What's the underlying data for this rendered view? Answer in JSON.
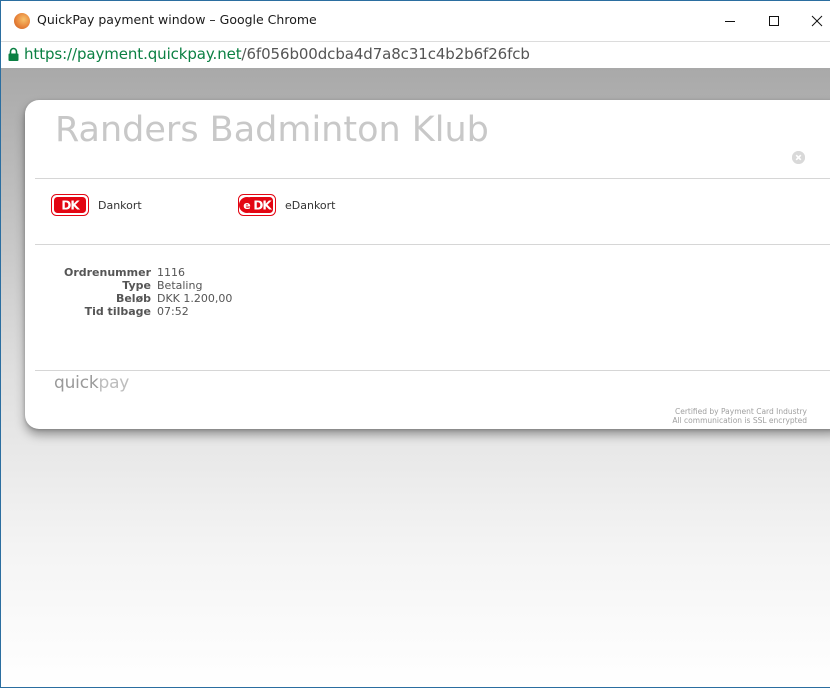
{
  "window": {
    "title": "QuickPay payment window – Google Chrome",
    "minimize_icon": "minimize-icon",
    "maximize_icon": "maximize-icon",
    "close_icon": "close-icon"
  },
  "address_bar": {
    "protocol": "https://",
    "host": "payment.quickpay.net",
    "path": "/6f056b00dcba4d7a8c31c4b2b6f26fcb",
    "secure_color": "#0b8043"
  },
  "payment": {
    "shop_name": "Randers Badminton Klub",
    "options": [
      {
        "label": "Dankort",
        "icon": "dankort-logo-icon",
        "color": "#e30613"
      },
      {
        "label": "eDankort",
        "icon": "edankort-logo-icon",
        "color": "#e30613"
      }
    ],
    "details": [
      {
        "key": "Ordrenummer",
        "value": "1116"
      },
      {
        "key": "Type",
        "value": "Betaling"
      },
      {
        "key": "Beløb",
        "value": "DKK 1.200,00"
      },
      {
        "key": "Tid tilbage",
        "value": "07:52"
      }
    ],
    "logo": {
      "part1": "quick",
      "part2": "pay"
    },
    "footer": {
      "line1": "Certified by Payment Card Industry",
      "line2": "All communication is SSL encrypted"
    }
  }
}
